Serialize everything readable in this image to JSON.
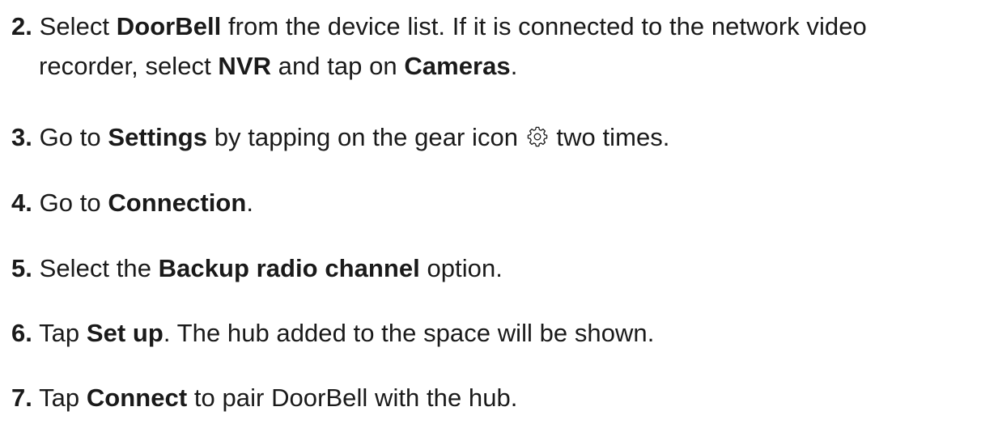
{
  "steps": [
    {
      "num": "2.",
      "line1": {
        "t1": " Select ",
        "b1": "DoorBell",
        "t2": " from the device list. If it is connected to the network video"
      },
      "line2": {
        "t1": "recorder, select ",
        "b1": "NVR",
        "t2": " and tap on ",
        "b2": "Cameras",
        "t3": "."
      }
    },
    {
      "num": "3.",
      "t1": " Go to ",
      "b1": "Settings",
      "t2": " by tapping on the gear icon ",
      "icon": "gear-icon",
      "t3": " two times."
    },
    {
      "num": "4.",
      "t1": " Go to ",
      "b1": "Connection",
      "t2": "."
    },
    {
      "num": "5.",
      "t1": " Select the ",
      "b1": "Backup radio channel",
      "t2": " option."
    },
    {
      "num": "6.",
      "t1": " Tap ",
      "b1": "Set up",
      "t2": ". The hub added to the space will be shown."
    },
    {
      "num": "7.",
      "t1": " Tap ",
      "b1": "Connect",
      "t2": " to pair DoorBell with the hub."
    }
  ]
}
